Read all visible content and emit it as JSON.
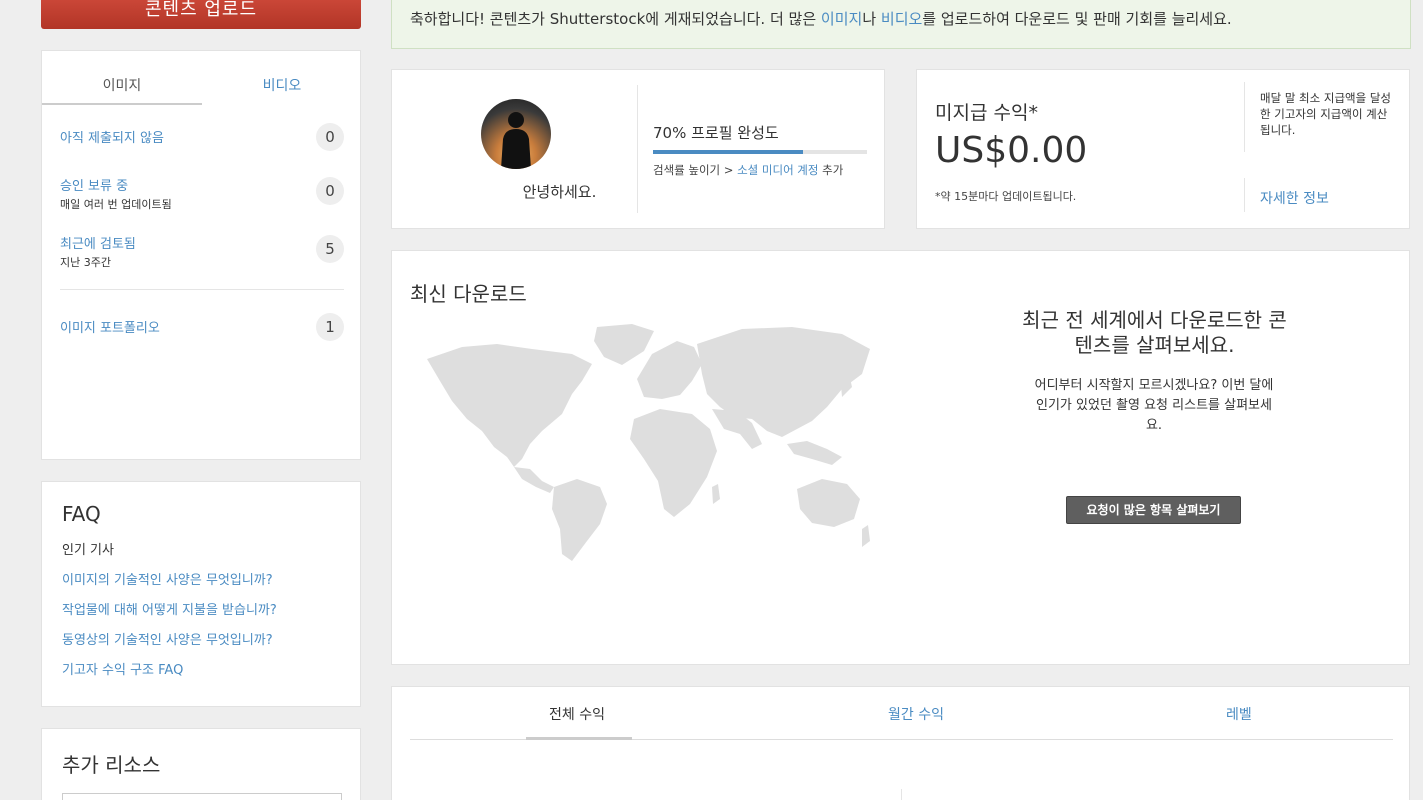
{
  "upload_button": "콘텐츠 업로드",
  "banner": {
    "prefix": "축하합니다! 콘텐츠가 Shutterstock에 게재되었습니다. 더 많은 ",
    "link1": "이미지",
    "mid": "나 ",
    "link2": "비디오",
    "suffix": "를 업로드하여 다운로드 및 판매 기회를 늘리세요."
  },
  "sidebar": {
    "tabs": [
      "이미지",
      "비디오"
    ],
    "items": [
      {
        "title": "아직 제출되지 않음",
        "sub": "",
        "count": "0"
      },
      {
        "title": "승인 보류 중",
        "sub": "매일 여러 번 업데이트됨",
        "count": "0"
      },
      {
        "title": "최근에 검토됨",
        "sub": "지난 3주간",
        "count": "5"
      },
      {
        "title": "이미지 포트폴리오",
        "sub": "",
        "count": "1"
      }
    ]
  },
  "faq": {
    "title": "FAQ",
    "popular": "인기 기사",
    "questions": [
      "이미지의 기술적인 사양은 무엇입니까?",
      "작업물에 대해 어떻게 지불을 받습니까?",
      "동영상의 기술적인 사양은 무엇입니까?",
      "기고자 수익 구조 FAQ"
    ]
  },
  "resources": {
    "title": "추가 리소스"
  },
  "profile": {
    "greeting": "안녕하세요.",
    "completion_label": "70% 프로필 완성도",
    "completion": 0.7,
    "boost_prefix": "검색률 높이기 > ",
    "boost_link": "소셜 미디어 계정",
    "boost_suffix": " 추가"
  },
  "earnings": {
    "label": "미지급 수익*",
    "amount": "US$0.00",
    "update_note": "*약 15분마다 업데이트됩니다.",
    "threshold_note": "매달 말 최소 지급액을 달성한 기고자의 지급액이 계산됩니다.",
    "more_link": "자세한 정보"
  },
  "downloads": {
    "title": "최신 다운로드",
    "headline": "최근 전 세계에서 다운로드한 콘텐츠를 살펴보세요.",
    "description": "어디부터 시작할지 모르시겠나요? 이번 달에 인기가 있었던 촬영 요청 리스트를 살펴보세요.",
    "button": "요청이 많은 항목 살펴보기"
  },
  "revenue_tabs": [
    "전체 수익",
    "월간 수익",
    "레벨"
  ],
  "colors": {
    "accent": "#4a8bc2",
    "upload": "#c0392b",
    "banner_bg": "#eef5e9"
  }
}
